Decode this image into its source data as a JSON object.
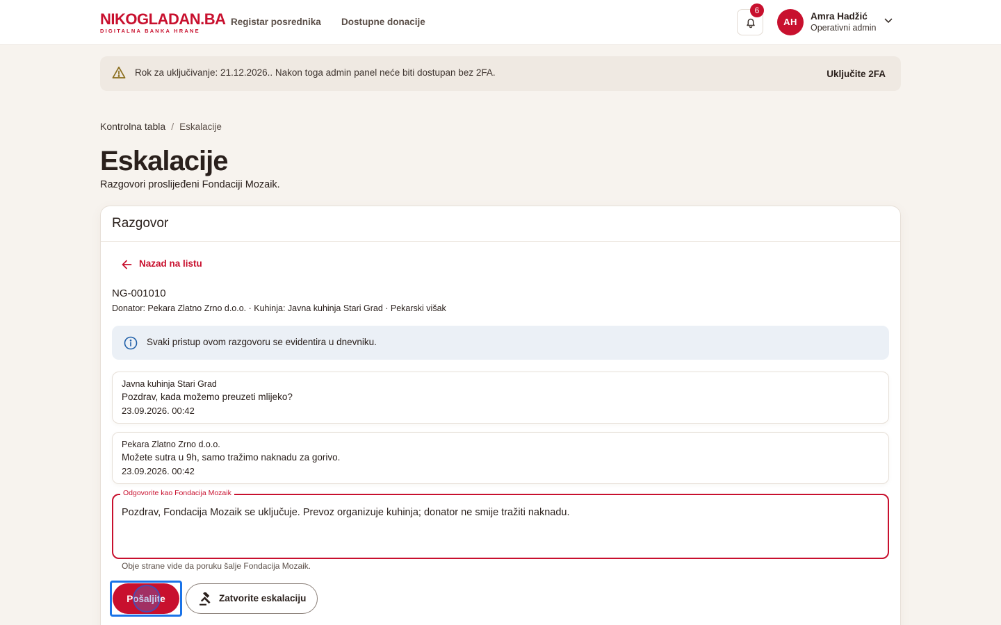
{
  "header": {
    "logo_main": "NIKOGLADAN.BA",
    "logo_sub": "DIGITALNA BANKA HRANE",
    "nav": [
      {
        "label": "Registar posrednika"
      },
      {
        "label": "Dostupne donacije"
      }
    ],
    "notifications_count": "6",
    "user": {
      "initials": "AH",
      "name": "Amra Hadžić",
      "role": "Operativni admin"
    }
  },
  "banner": {
    "text": "Rok za uključivanje: 21.12.2026.. Nakon toga admin panel neće biti dostupan bez 2FA.",
    "action": "Uključite 2FA"
  },
  "breadcrumb": {
    "root": "Kontrolna tabla",
    "separator": "/",
    "current": "Eskalacije"
  },
  "page": {
    "title": "Eskalacije",
    "subtitle": "Razgovori proslijeđeni Fondaciji Mozaik."
  },
  "card": {
    "title": "Razgovor",
    "back_label": "Nazad na listu",
    "conversation_id": "NG-001010",
    "meta": "Donator: Pekara Zlatno Zrno d.o.o. · Kuhinja: Javna kuhinja Stari Grad · Pekarski višak",
    "info": "Svaki pristup ovom razgovoru se evidentira u dnevniku.",
    "messages": [
      {
        "sender": "Javna kuhinja Stari Grad",
        "body": "Pozdrav, kada možemo preuzeti mlijeko?",
        "time": "23.09.2026. 00:42"
      },
      {
        "sender": "Pekara Zlatno Zrno d.o.o.",
        "body": "Možete sutra u 9h, samo tražimo naknadu za gorivo.",
        "time": "23.09.2026. 00:42"
      }
    ],
    "reply": {
      "label": "Odgovorite kao Fondacija Mozaik",
      "value": "Pozdrav, Fondacija Mozaik se uključuje. Prevoz organizuje kuhinja; donator ne smije tražiti naknadu.",
      "helper": "Obje strane vide da poruku šalje Fondacija Mozaik."
    },
    "actions": {
      "send": "Pošaljite",
      "close": "Zatvorite eskalaciju"
    }
  },
  "colors": {
    "brand": "#c8102e",
    "background": "#f7f3ee",
    "info_bg": "#ebf0f6",
    "focus": "#1a73e8"
  },
  "icons": {
    "notification": "bell-icon",
    "user_menu": "chevron-down-icon",
    "warning": "warning-triangle-icon",
    "back": "arrow-left-icon",
    "info": "info-circle-icon",
    "close_escalation": "gavel-icon"
  }
}
